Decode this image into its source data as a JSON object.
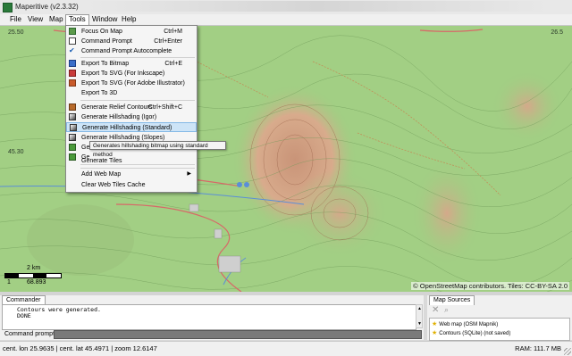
{
  "window": {
    "title": "Maperitive (v2.3.32)"
  },
  "menubar": {
    "items": [
      "File",
      "View",
      "Map",
      "Tools",
      "Window",
      "Help"
    ],
    "active": "Tools"
  },
  "tools_menu": {
    "items": [
      {
        "label": "Focus On Map",
        "shortcut": "Ctrl+M",
        "icon": "focus-map-icon"
      },
      {
        "label": "Command Prompt",
        "shortcut": "Ctrl+Enter",
        "icon": "command-prompt-icon"
      },
      {
        "label": "Command Prompt Autocomplete",
        "shortcut": "",
        "icon": "checkmark-icon"
      },
      {
        "label": "Export To Bitmap",
        "shortcut": "Ctrl+E",
        "icon": "bitmap-icon"
      },
      {
        "label": "Export To SVG (For Inkscape)",
        "shortcut": "",
        "icon": "svg-inkscape-icon"
      },
      {
        "label": "Export To SVG (For Adobe Illustrator)",
        "shortcut": "",
        "icon": "svg-illustrator-icon"
      },
      {
        "label": "Export To 3D",
        "shortcut": "",
        "icon": ""
      },
      {
        "label": "Generate Relief Contours",
        "shortcut": "Ctrl+Shift+C",
        "icon": "contours-icon"
      },
      {
        "label": "Generate Hillshading (Igor)",
        "shortcut": "",
        "icon": "hillshade-icon"
      },
      {
        "label": "Generate Hillshading (Standard)",
        "shortcut": "",
        "icon": "hillshade-icon"
      },
      {
        "label": "Generate Hillshading (Slopes)",
        "shortcut": "",
        "icon": "hillshade-icon"
      },
      {
        "label": "Ge",
        "shortcut": "",
        "icon": "generate-icon"
      },
      {
        "label": "Ge",
        "shortcut": "",
        "icon": "generate-icon"
      },
      {
        "label": "Generate Tiles",
        "shortcut": "",
        "icon": ""
      },
      {
        "label": "Add Web Map",
        "shortcut": "",
        "icon": ""
      },
      {
        "label": "Clear Web Tiles Cache",
        "shortcut": "",
        "icon": ""
      }
    ],
    "highlighted": "Generate Hillshading (Standard)",
    "tooltip": "Generates hillshading bitmap using standard method"
  },
  "map": {
    "coords": {
      "top_left": "25.50",
      "top_right": "26.5",
      "left_mid": "45.30"
    },
    "scale": {
      "top_label": "2 km",
      "left_label": "1",
      "right_label": "68.893"
    },
    "attribution": "© OpenStreetMap contributors. Tiles: CC-BY-SA 2.0"
  },
  "commander": {
    "tab": "Commander",
    "output_lines": [
      "Contours were generated.",
      "DONE"
    ],
    "prompt_label": "Command prompt:"
  },
  "map_sources": {
    "tab": "Map Sources",
    "items": [
      "Web map (OSM Mapnik)",
      "Contours (SQLite) (not saved)"
    ]
  },
  "statusbar": {
    "coords": "cent. lon 25.9635 | cent. lat 45.4971 | zoom 12.6147",
    "ram": "RAM: 111.7 MB"
  },
  "colors": {
    "menu_highlight": "#cde4f7",
    "map_base": "#9fcd82",
    "map_relief": "#d9a88a"
  }
}
